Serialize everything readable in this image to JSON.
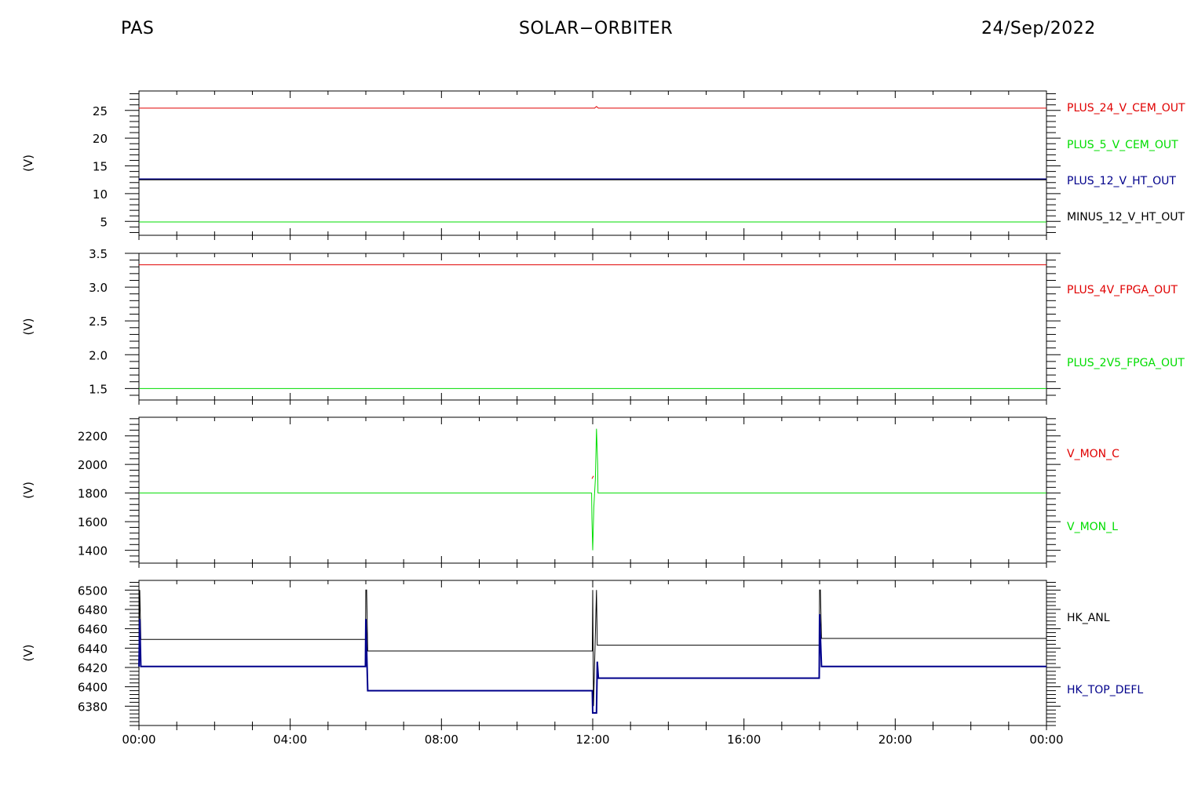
{
  "header": {
    "left": "PAS",
    "center": "SOLAR−ORBITER",
    "date": "24/Sep/2022"
  },
  "colors": {
    "red": "#e00000",
    "green": "#00dd00",
    "blue": "#00008b",
    "black": "#000000"
  },
  "chart_data": [
    {
      "type": "line",
      "ylabel": "(V)",
      "ylim": [
        2.5,
        28.5
      ],
      "yticks": [
        5,
        10,
        15,
        20,
        25
      ],
      "ytick_labels": [
        "5",
        "10",
        "15",
        "20",
        "25"
      ],
      "x_hours": [
        0,
        24
      ],
      "series": [
        {
          "name": "PLUS_24_V_CEM_OUT",
          "color": "red",
          "x": [
            0,
            12.05,
            12.1,
            12.15,
            24
          ],
          "y": [
            25.4,
            25.4,
            25.7,
            25.4,
            25.4
          ]
        },
        {
          "name": "PLUS_5_V_CEM_OUT",
          "color": "green",
          "x": [
            0,
            24
          ],
          "y": [
            4.9,
            4.9
          ]
        },
        {
          "name": "PLUS_12_V_HT_OUT",
          "color": "blue",
          "x": [
            0,
            24
          ],
          "y": [
            12.6,
            12.6
          ]
        },
        {
          "name": "MINUS_12_V_HT_OUT",
          "color": "black",
          "x": [
            0,
            24
          ],
          "y": [
            12.5,
            12.5
          ]
        }
      ]
    },
    {
      "type": "line",
      "ylabel": "(V)",
      "ylim": [
        1.33,
        3.5
      ],
      "yticks": [
        1.5,
        2.0,
        2.5,
        3.0,
        3.5
      ],
      "ytick_labels": [
        "1.5",
        "2.0",
        "2.5",
        "3.0",
        "3.5"
      ],
      "x_hours": [
        0,
        24
      ],
      "series": [
        {
          "name": "PLUS_4V_FPGA_OUT",
          "color": "red",
          "x": [
            0,
            24
          ],
          "y": [
            3.33,
            3.33
          ]
        },
        {
          "name": "PLUS_2V5_FPGA_OUT",
          "color": "green",
          "x": [
            0,
            24
          ],
          "y": [
            1.5,
            1.5
          ]
        }
      ]
    },
    {
      "type": "line",
      "ylabel": "(V)",
      "ylim": [
        1310,
        2330
      ],
      "yticks": [
        1400,
        1600,
        1800,
        2000,
        2200
      ],
      "ytick_labels": [
        "1400",
        "1600",
        "1800",
        "2000",
        "2200"
      ],
      "x_hours": [
        0,
        24
      ],
      "series": [
        {
          "name": "V_MON_C",
          "color": "red",
          "x": [
            11.98,
            12.02
          ],
          "y": [
            1900,
            1920
          ]
        },
        {
          "name": "V_MON_L",
          "color": "green",
          "x": [
            0,
            11.97,
            11.98,
            12.0,
            12.03,
            12.07,
            12.1,
            12.13,
            12.14,
            12.15,
            24
          ],
          "y": [
            1800,
            1800,
            1620,
            1400,
            1700,
            1900,
            2250,
            2000,
            1800,
            1800,
            1800
          ]
        }
      ]
    },
    {
      "type": "line",
      "ylabel": "(V)",
      "ylim": [
        6360,
        6510
      ],
      "yticks": [
        6380,
        6400,
        6420,
        6440,
        6460,
        6480,
        6500
      ],
      "ytick_labels": [
        "6380",
        "6400",
        "6420",
        "6440",
        "6460",
        "6480",
        "6500"
      ],
      "x_hours": [
        0,
        24
      ],
      "series": [
        {
          "name": "HK_ANL",
          "color": "black",
          "x": [
            0,
            0.02,
            0.05,
            5.99,
            6.0,
            6.02,
            6.05,
            11.99,
            12.0,
            12.02,
            12.1,
            12.12,
            12.14,
            12.16,
            17.99,
            18.0,
            18.02,
            18.05,
            24
          ],
          "y": [
            6449,
            6500,
            6449,
            6449,
            6500,
            6500,
            6437,
            6437,
            6500,
            6380,
            6500,
            6443,
            6443,
            6443,
            6443,
            6500,
            6500,
            6450,
            6450
          ]
        },
        {
          "name": "HK_TOP_DEFL",
          "color": "blue",
          "x": [
            0,
            0.02,
            0.05,
            5.99,
            6.0,
            6.05,
            11.99,
            12.0,
            12.1,
            12.12,
            12.15,
            17.99,
            18.0,
            18.05,
            24
          ],
          "y": [
            6421,
            6470,
            6421,
            6421,
            6470,
            6396,
            6396,
            6373,
            6373,
            6426,
            6409,
            6409,
            6475,
            6421,
            6421
          ]
        }
      ]
    }
  ],
  "xaxis": {
    "tick_hours": [
      0,
      4,
      8,
      12,
      16,
      20,
      24
    ],
    "tick_labels": [
      "00:00",
      "04:00",
      "08:00",
      "12:00",
      "16:00",
      "20:00",
      "00:00"
    ]
  }
}
